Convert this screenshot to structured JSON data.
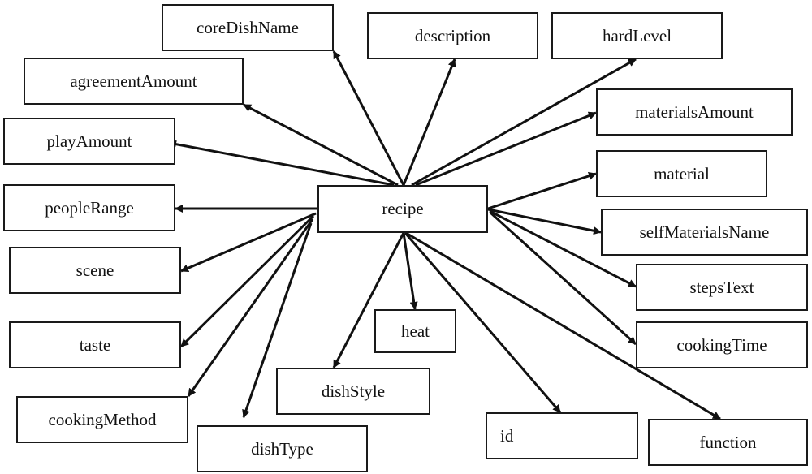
{
  "diagram": {
    "type": "entity-attribute",
    "line_color": "#111111",
    "center": {
      "id": "recipe",
      "label": "recipe"
    },
    "attributes": [
      {
        "id": "coreDishName",
        "label": "coreDishName"
      },
      {
        "id": "description",
        "label": "description"
      },
      {
        "id": "hardLevel",
        "label": "hardLevel"
      },
      {
        "id": "agreementAmount",
        "label": "agreementAmount"
      },
      {
        "id": "materialsAmount",
        "label": "materialsAmount"
      },
      {
        "id": "playAmount",
        "label": "playAmount"
      },
      {
        "id": "material",
        "label": "material"
      },
      {
        "id": "peopleRange",
        "label": "peopleRange"
      },
      {
        "id": "selfMaterialsName",
        "label": "selfMaterialsName"
      },
      {
        "id": "scene",
        "label": "scene"
      },
      {
        "id": "stepsText",
        "label": "stepsText"
      },
      {
        "id": "heat",
        "label": "heat"
      },
      {
        "id": "taste",
        "label": "taste"
      },
      {
        "id": "cookingTime",
        "label": "cookingTime"
      },
      {
        "id": "dishStyle",
        "label": "dishStyle"
      },
      {
        "id": "cookingMethod",
        "label": "cookingMethod"
      },
      {
        "id": "id",
        "label": "id"
      },
      {
        "id": "dishType",
        "label": "dishType"
      },
      {
        "id": "function",
        "label": "function"
      }
    ],
    "edges": [
      {
        "from": "recipe",
        "to": "coreDishName"
      },
      {
        "from": "recipe",
        "to": "description"
      },
      {
        "from": "recipe",
        "to": "hardLevel"
      },
      {
        "from": "recipe",
        "to": "agreementAmount"
      },
      {
        "from": "recipe",
        "to": "materialsAmount"
      },
      {
        "from": "recipe",
        "to": "playAmount"
      },
      {
        "from": "recipe",
        "to": "material"
      },
      {
        "from": "recipe",
        "to": "peopleRange"
      },
      {
        "from": "recipe",
        "to": "selfMaterialsName"
      },
      {
        "from": "recipe",
        "to": "scene"
      },
      {
        "from": "recipe",
        "to": "stepsText"
      },
      {
        "from": "recipe",
        "to": "heat"
      },
      {
        "from": "recipe",
        "to": "taste"
      },
      {
        "from": "recipe",
        "to": "cookingTime"
      },
      {
        "from": "recipe",
        "to": "dishStyle"
      },
      {
        "from": "recipe",
        "to": "cookingMethod"
      },
      {
        "from": "recipe",
        "to": "id"
      },
      {
        "from": "recipe",
        "to": "dishType"
      },
      {
        "from": "recipe",
        "to": "function"
      }
    ]
  }
}
